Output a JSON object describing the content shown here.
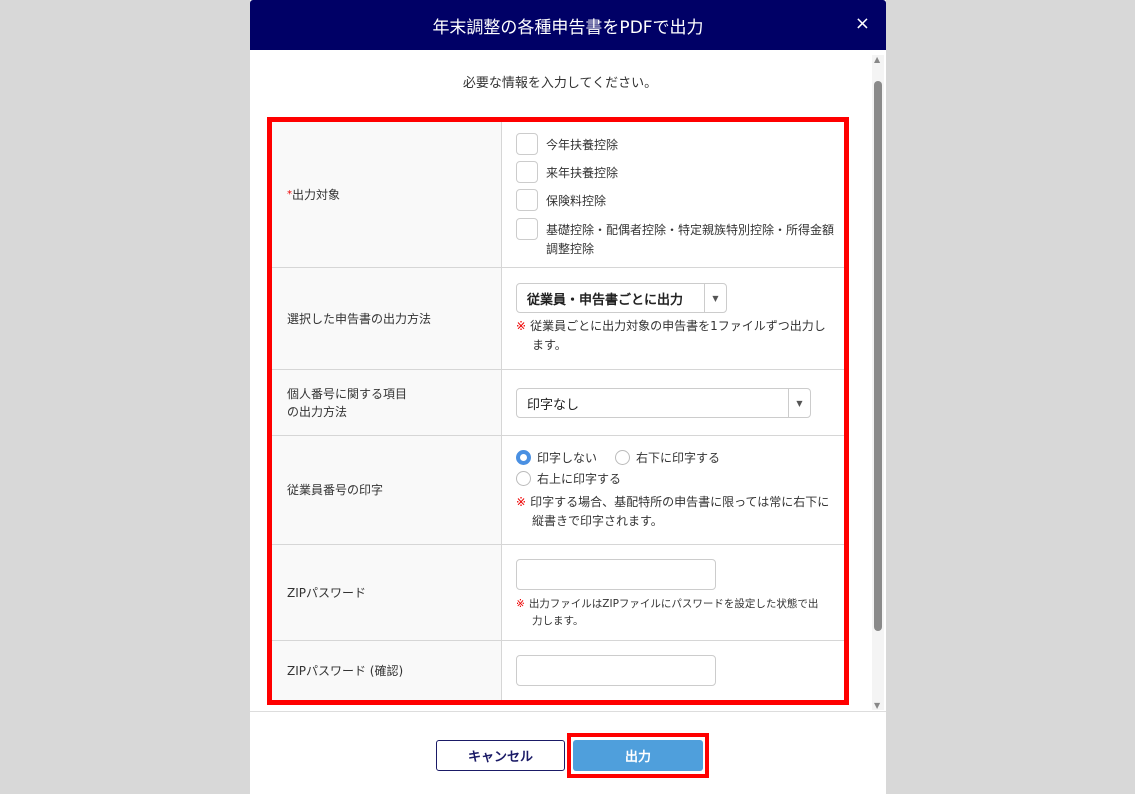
{
  "dialog": {
    "title": "年末調整の各種申告書をPDFで出力",
    "close": "×",
    "intro": "必要な情報を入力してください。"
  },
  "form": {
    "output_target": {
      "required": "*",
      "label": "出力対象",
      "options": [
        "今年扶養控除",
        "来年扶養控除",
        "保険料控除",
        "基礎控除・配偶者控除・特定親族特別控除・所得金額調整控除"
      ]
    },
    "output_method": {
      "label": "選択した申告書の出力方法",
      "value": "従業員・申告書ごとに出力",
      "note_mark": "※",
      "note": "従業員ごとに出力対象の申告書を1ファイルずつ出力します。"
    },
    "mynumber": {
      "label": "個人番号に関する項目の出力方法",
      "label_line1": "個人番号に関する項目",
      "label_line2": "の出力方法",
      "value": "印字なし"
    },
    "employee_no": {
      "label": "従業員番号の印字",
      "options": [
        "印字しない",
        "右下に印字する",
        "右上に印字する"
      ],
      "selected": "印字しない",
      "note_mark": "※",
      "note": "印字する場合、基配特所の申告書に限っては常に右下に縦書きで印字されます。"
    },
    "zip_password": {
      "label": "ZIPパスワード",
      "value": "",
      "note_mark": "※",
      "note": "出力ファイルはZIPファイルにパスワードを設定した状態で出力します。"
    },
    "zip_password_confirm": {
      "label": "ZIPパスワード (確認)",
      "value": ""
    }
  },
  "buttons": {
    "cancel": "キャンセル",
    "output": "出力"
  },
  "colors": {
    "header": "#000066",
    "primary": "#4f9fdc",
    "highlight": "#ff0000"
  }
}
